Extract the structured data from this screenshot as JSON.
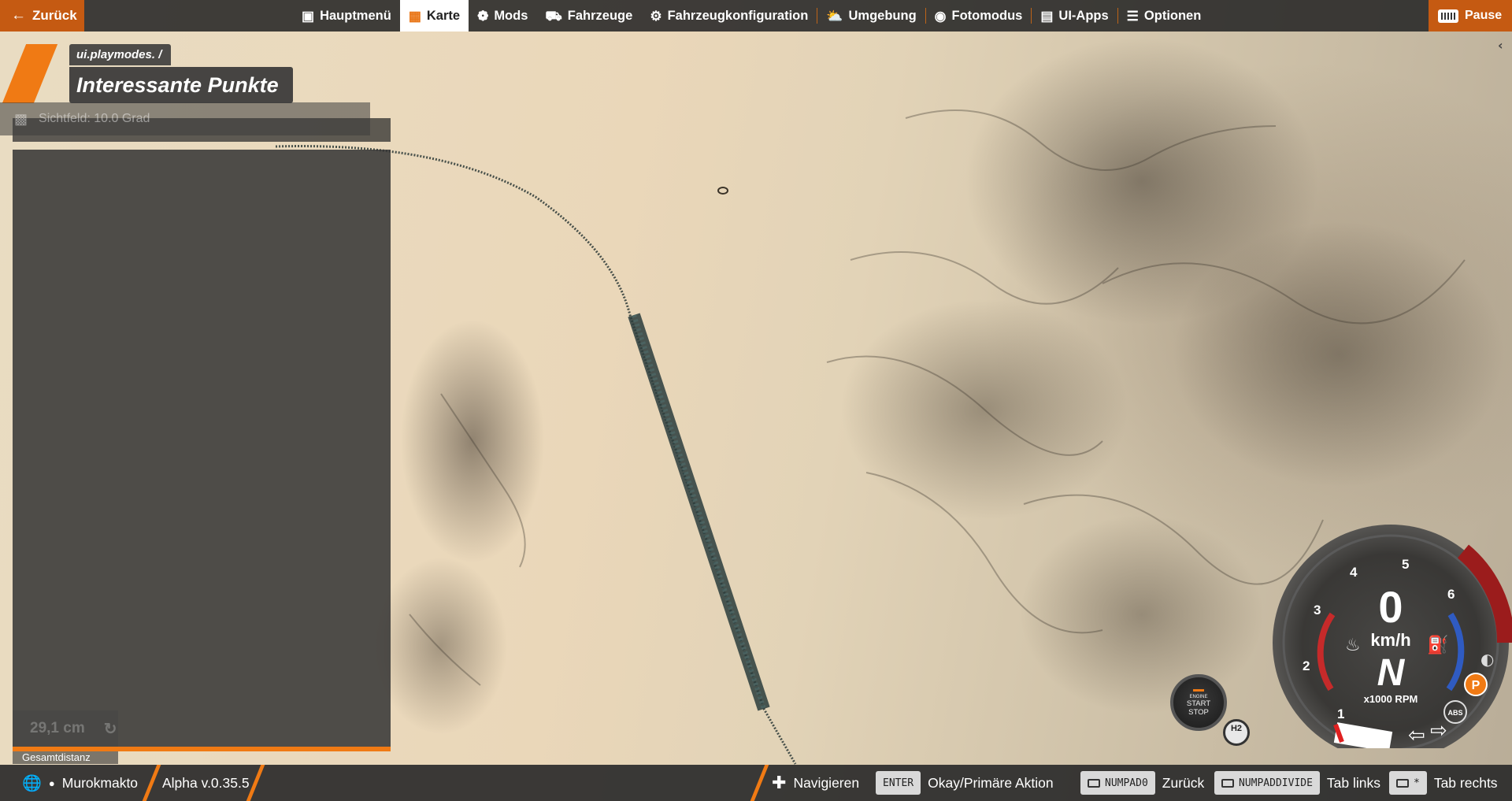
{
  "topbar": {
    "back_label": "Zurück",
    "pause_label": "Pause",
    "tabs": [
      {
        "label": "Hauptmenü",
        "icon": "home-star-icon",
        "active": false
      },
      {
        "label": "Karte",
        "icon": "map-icon",
        "active": true
      },
      {
        "label": "Mods",
        "icon": "puzzle-icon",
        "active": false
      },
      {
        "label": "Fahrzeuge",
        "icon": "car-icon",
        "active": false
      },
      {
        "label": "Fahrzeugkonfiguration",
        "icon": "engine-icon",
        "active": false
      },
      {
        "label": "Umgebung",
        "icon": "weather-icon",
        "active": false
      },
      {
        "label": "Fotomodus",
        "icon": "camera-icon",
        "active": false
      },
      {
        "label": "UI-Apps",
        "icon": "ui-apps-icon",
        "active": false
      },
      {
        "label": "Optionen",
        "icon": "sliders-icon",
        "active": false
      }
    ],
    "accent_color": "#f07a14"
  },
  "header": {
    "breadcrumb": "ui.playmodes. /",
    "title": "Interessante Punkte",
    "fov_text": "Sichtfeld: 10.0 Grad"
  },
  "left_panel": {
    "distance_value": "29,1 cm",
    "distance_label": "Gesamtdistanz"
  },
  "bottombar": {
    "user_name": "Murokmakto",
    "version": "Alpha v.0.35.5",
    "navigate_label": "Navigieren",
    "hints": [
      {
        "key": "ENTER",
        "label": "Okay/Primäre Aktion"
      },
      {
        "key": "NUMPAD0",
        "label": "Zurück"
      },
      {
        "key": "NUMPADDIVIDE",
        "label": "Tab links"
      },
      {
        "key": "*",
        "label": "Tab rechts"
      }
    ]
  },
  "vehicle_hud": {
    "engine_button_top": "ENGINE",
    "engine_button_main": "START\nSTOP",
    "h2_label": "H2",
    "speed": "0",
    "speed_unit": "km/h",
    "gear": "N",
    "rpm_unit": "x1000 RPM",
    "rpm_ticks": [
      "1",
      "2",
      "3",
      "4",
      "5",
      "6"
    ],
    "park_label": "P",
    "abs_label": "ABS"
  }
}
